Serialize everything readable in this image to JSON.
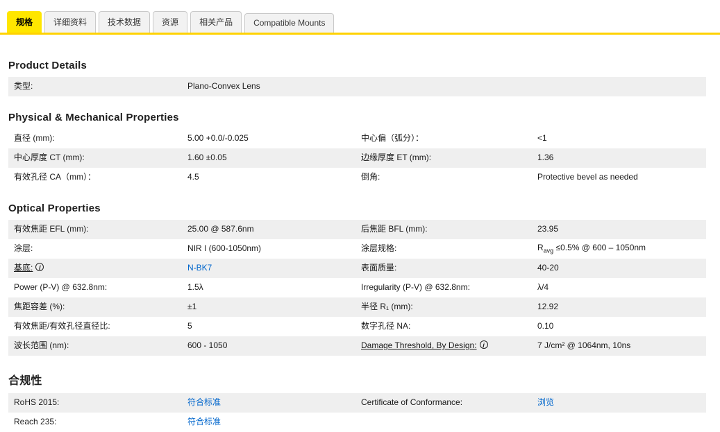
{
  "tabs": {
    "items": [
      "规格",
      "详细资料",
      "技术数据",
      "资源",
      "相关产品",
      "Compatible Mounts"
    ]
  },
  "colors": {
    "accent_yellow": "#ffe600",
    "tab_underline": "#ffd200",
    "link_blue": "#0066cc",
    "row_shade": "#efefef"
  },
  "product_details": {
    "title": "Product Details",
    "rows": [
      {
        "l1": "类型:",
        "v1": "Plano-Convex Lens"
      }
    ]
  },
  "physical": {
    "title": "Physical & Mechanical Properties",
    "rows": [
      {
        "l1": "直径 (mm):",
        "v1": "5.00 +0.0/-0.025",
        "l2": "中心偏（弧分）：",
        "v2": "<1"
      },
      {
        "l1": "中心厚度 CT (mm):",
        "v1": "1.60 ±0.05",
        "l2": "边缘厚度 ET (mm):",
        "v2": "1.36"
      },
      {
        "l1": "有效孔径 CA（mm）：",
        "v1": "4.5",
        "l2": "倒角:",
        "v2": "Protective bevel as needed"
      }
    ]
  },
  "optical": {
    "title": "Optical Properties",
    "rows": [
      {
        "l1": "有效焦距 EFL (mm):",
        "v1": "25.00 @ 587.6nm",
        "l2": "后焦距 BFL (mm):",
        "v2": "23.95"
      },
      {
        "l1": "涂层:",
        "v1": "NIR I (600-1050nm)",
        "l2": "涂层规格:",
        "v2_parts": {
          "base": "R",
          "sub": "avg",
          "rest": " ≤0.5% @ 600 – 1050nm"
        }
      },
      {
        "l1": "基底:",
        "v1": "N-BK7",
        "l2": "表面质量:",
        "v2": "40-20"
      },
      {
        "l1": "Power (P-V) @ 632.8nm:",
        "v1": "1.5λ",
        "l2": "Irregularity (P-V) @ 632.8nm:",
        "v2": "λ/4"
      },
      {
        "l1": "焦距容差 (%):",
        "v1": "±1",
        "l2": "半径 R₁ (mm):",
        "v2": "12.92"
      },
      {
        "l1": "有效焦距/有效孔径直径比:",
        "v1": "5",
        "l2": "数字孔径 NA:",
        "v2": "0.10"
      },
      {
        "l1": "波长范围 (nm):",
        "v1": "600 - 1050",
        "l2": "Damage Threshold, By Design:",
        "v2": "7 J/cm² @ 1064nm, 10ns"
      }
    ]
  },
  "compliance": {
    "title": "合规性",
    "rows": [
      {
        "l1": "RoHS 2015:",
        "v1": "符合标准",
        "l2": "Certificate of Conformance:",
        "v2": "浏览"
      },
      {
        "l1": "Reach 235:",
        "v1": "符合标准"
      }
    ]
  }
}
